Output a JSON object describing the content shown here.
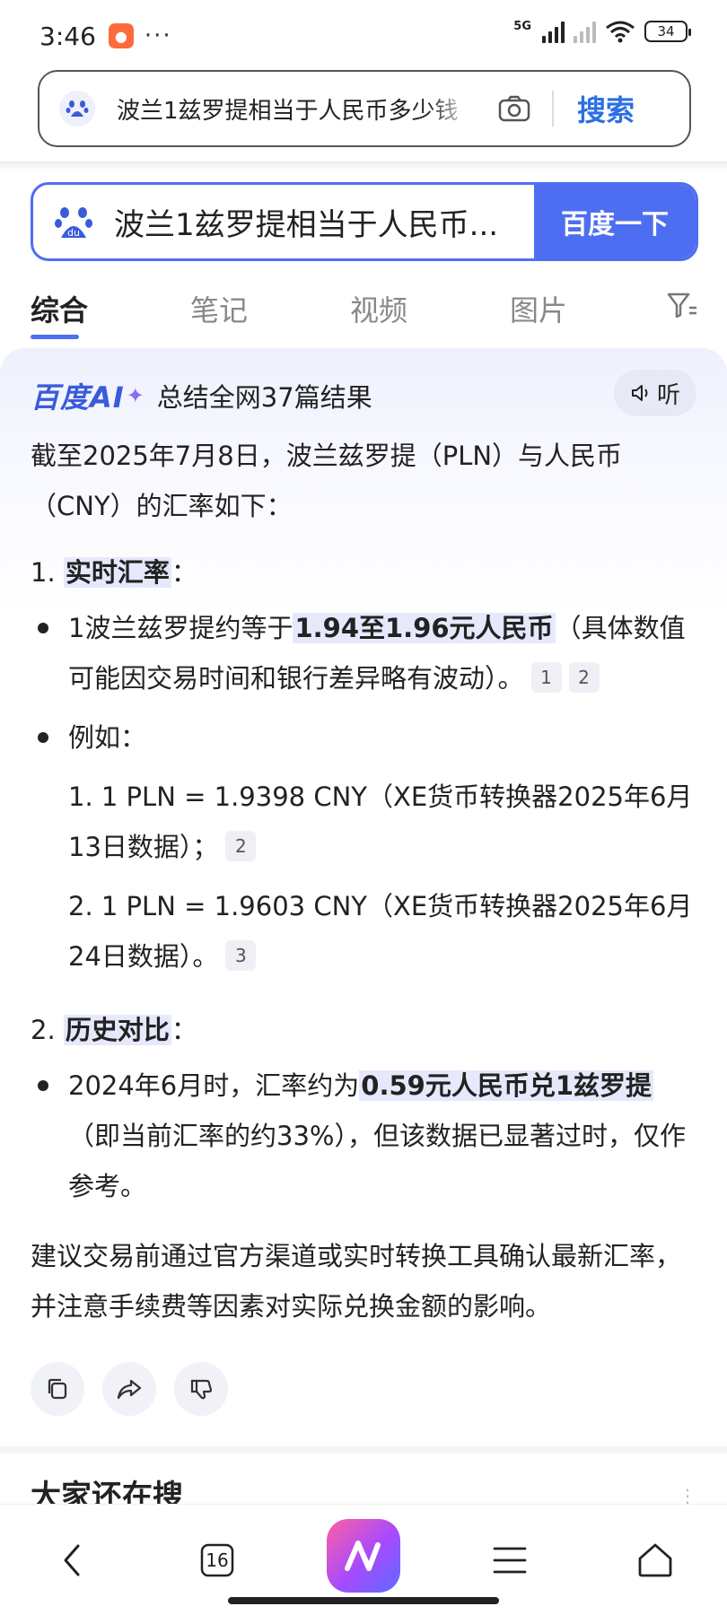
{
  "status_bar": {
    "time": "3:46",
    "network": "5G",
    "battery": "34"
  },
  "address_bar": {
    "query": "波兰1兹罗提相当于人民币多少钱",
    "search_label": "搜索"
  },
  "baidu_box": {
    "query": "波兰1兹罗提相当于人民币...",
    "button_label": "百度一下"
  },
  "tabs": [
    {
      "label": "综合",
      "active": true
    },
    {
      "label": "笔记",
      "active": false
    },
    {
      "label": "视频",
      "active": false
    },
    {
      "label": "图片",
      "active": false
    }
  ],
  "ai_card": {
    "brand": "百度AI",
    "summary": "总结全网37篇结果",
    "listen_label": "听",
    "intro": "截至2025年7月8日，波兰兹罗提（PLN）与人民币（CNY）的汇率如下：",
    "section1": {
      "number": "1.",
      "title": "实时汇率",
      "colon": "：",
      "bullet1_pre": "1波兰兹罗提约等于",
      "bullet1_hl": "1.94至1.96元人民币",
      "bullet1_post": "（具体数值可能因交易时间和银行差异略有波动）。",
      "bullet1_cites": [
        "1",
        "2"
      ],
      "bullet2": "例如：",
      "example1": "1. 1 PLN = 1.9398 CNY（XE货币转换器2025年6月13日数据）；",
      "example1_cite": "2",
      "example2": "2. 1 PLN = 1.9603 CNY（XE货币转换器2025年6月24日数据）。",
      "example2_cite": "3"
    },
    "section2": {
      "number": "2.",
      "title": "历史对比",
      "colon": "：",
      "bullet_pre": "2024年6月时，汇率约为",
      "bullet_hl": "0.59元人民币兑1兹罗提",
      "bullet_post": "（即当前汇率的约33%），但该数据已显著过时，仅作参考。"
    },
    "advice": "建议交易前通过官方渠道或实时转换工具确认最新汇率，并注意手续费等因素对实际兑换金额的影响。"
  },
  "peek": {
    "title": "大家还在搜"
  },
  "bottom_nav": {
    "tab_count": "16"
  },
  "colors": {
    "accent": "#4e6ef2",
    "search_blue": "#2b6fe3",
    "highlight": "#e6e9fb"
  }
}
